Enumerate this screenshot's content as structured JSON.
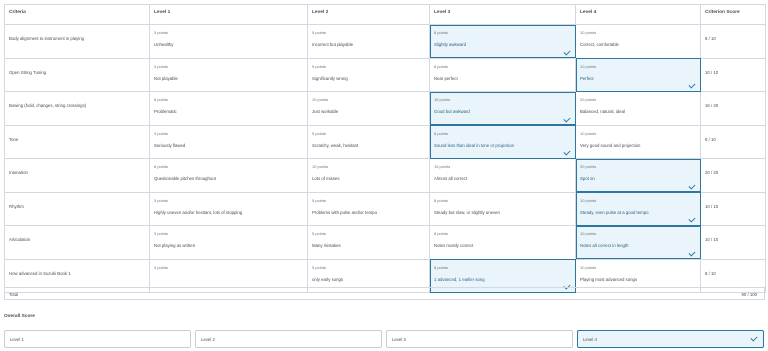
{
  "rubric": {
    "headers": [
      "Criteria",
      "Level 1",
      "Level 2",
      "Level 3",
      "Level 4",
      "Criterion Score"
    ],
    "rows": [
      {
        "criterion": "Body alignment to instrument in playing",
        "levels": [
          {
            "points": "3 points",
            "desc": "Unhealthy"
          },
          {
            "points": "5 points",
            "desc": "Incorrect but playable"
          },
          {
            "points": "8 points",
            "desc": "Slightly awkward"
          },
          {
            "points": "10 points",
            "desc": "Correct, comfortable"
          }
        ],
        "selected": 2,
        "score": "8 / 10"
      },
      {
        "criterion": "Open String Tuning",
        "levels": [
          {
            "points": "3 points",
            "desc": "Not playable"
          },
          {
            "points": "5 points",
            "desc": "Significantly wrong"
          },
          {
            "points": "8 points",
            "desc": "Near perfect"
          },
          {
            "points": "10 points",
            "desc": "Perfect"
          }
        ],
        "selected": 3,
        "score": "10 / 10"
      },
      {
        "criterion": "Bowing (hold, changes, string crossings)",
        "levels": [
          {
            "points": "6 points",
            "desc": "Problematic"
          },
          {
            "points": "10 points",
            "desc": "Just workable"
          },
          {
            "points": "16 points",
            "desc": "Good but awkward"
          },
          {
            "points": "20 points",
            "desc": "Balanced, natural, ideal"
          }
        ],
        "selected": 2,
        "score": "16 / 20"
      },
      {
        "criterion": "Tone",
        "levels": [
          {
            "points": "3 points",
            "desc": "Seriously flawed"
          },
          {
            "points": "5 points",
            "desc": "Scratchy, weak, hesitant"
          },
          {
            "points": "8 points",
            "desc": "Sound less than ideal in tone or projection"
          },
          {
            "points": "10 points",
            "desc": "Very good sound and projection"
          }
        ],
        "selected": 2,
        "score": "8 / 10"
      },
      {
        "criterion": "Intonation",
        "levels": [
          {
            "points": "6 points",
            "desc": "Questionable pitches throughout"
          },
          {
            "points": "10 points",
            "desc": "Lots of misses"
          },
          {
            "points": "15 points",
            "desc": "Almost all correct"
          },
          {
            "points": "20 points",
            "desc": "Spot on"
          }
        ],
        "selected": 3,
        "score": "20 / 20"
      },
      {
        "criterion": "Rhythm",
        "levels": [
          {
            "points": "3 points",
            "desc": "Highly uneven and/or hesitant, lots of stopping"
          },
          {
            "points": "5 points",
            "desc": "Problems with pulse and/or tempo"
          },
          {
            "points": "8 points",
            "desc": "Steady but slow, or slightly uneven"
          },
          {
            "points": "10 points",
            "desc": "Steady, even pulse at a good tempo"
          }
        ],
        "selected": 3,
        "score": "10 / 10"
      },
      {
        "criterion": "Articulation",
        "levels": [
          {
            "points": "3 points",
            "desc": "Not playing as written"
          },
          {
            "points": "5 points",
            "desc": "Many mistakes"
          },
          {
            "points": "8 points",
            "desc": "Notes mostly correct"
          },
          {
            "points": "10 points",
            "desc": "Notes all correct in length"
          }
        ],
        "selected": 3,
        "score": "10 / 10"
      },
      {
        "criterion": "How advanced in Suzuki Book 1",
        "levels": [
          {
            "points": "3 points",
            "desc": ""
          },
          {
            "points": "5 points",
            "desc": "only early songs"
          },
          {
            "points": "8 points",
            "desc": "1 advanced, 1 earlier song"
          },
          {
            "points": "10 points",
            "desc": "Playing most advanced songs"
          }
        ],
        "selected": 2,
        "score": "8 / 10"
      }
    ]
  },
  "total": {
    "label": "Total",
    "value": "90 / 100"
  },
  "overall": {
    "title": "Overall Score",
    "levels": [
      "Level 1",
      "Level 2",
      "Level 3",
      "Level 4"
    ],
    "selected": 3
  },
  "colors": {
    "selected_bg": "#e9f5fb",
    "selected_border": "#2c76a0",
    "border": "#d3d9e3"
  },
  "icons": {
    "selected_marker": "checkmark-icon"
  }
}
